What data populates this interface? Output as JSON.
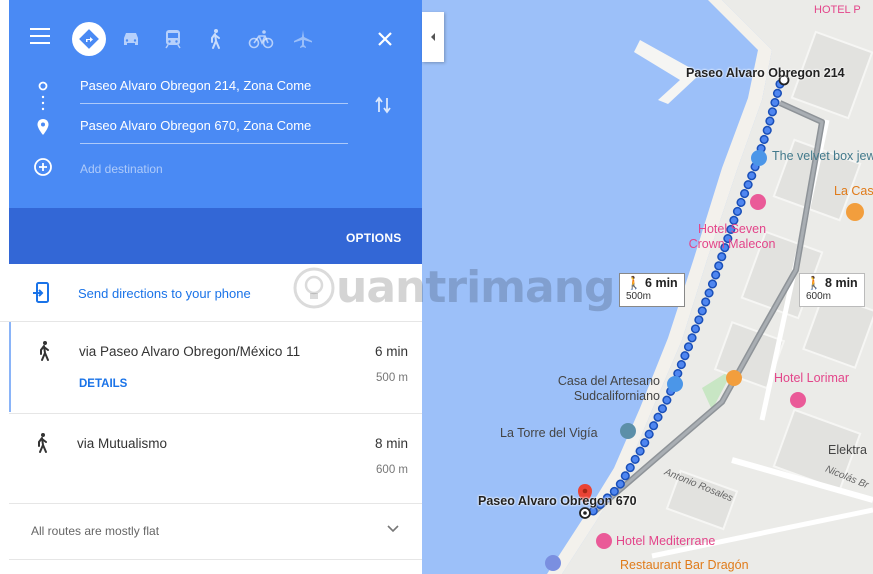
{
  "directions": {
    "travel_modes": [
      "drive",
      "car",
      "transit",
      "walk",
      "bicycle",
      "flight"
    ],
    "origin": "Paseo Alvaro Obregon 214, Zona Come",
    "destination": "Paseo Alvaro Obregon 670, Zona Come",
    "add_destination_placeholder": "Add destination",
    "options_label": "OPTIONS"
  },
  "send_to_phone": {
    "label": "Send directions to your phone"
  },
  "routes": [
    {
      "via": "via Paseo Alvaro Obregon/México 11",
      "time": "6 min",
      "distance": "500 m",
      "details_label": "DETAILS"
    },
    {
      "via": "via Mutualismo",
      "time": "8 min",
      "distance": "600 m"
    }
  ],
  "footer": {
    "flat_note": "All routes are mostly flat"
  },
  "map": {
    "start_label": "Paseo Alvaro Obregon 214",
    "end_label": "Paseo Alvaro Obregon 670",
    "route_badges": [
      {
        "time": "6 min",
        "distance": "500m"
      },
      {
        "time": "8 min",
        "distance": "600m"
      }
    ],
    "places": {
      "hotel_top": "HOTEL P",
      "velvet": "The velvet box jewelry la paz",
      "la_cas": "La Cas",
      "hotel_seven": "Hotel Seven Crown Malecon",
      "hotel_lorimar": "Hotel Lorimar",
      "casa_artesano": "Casa del Artesano Sudcaliforniano",
      "torre_vigia": "La Torre del Vigía",
      "elektra": "Elektra",
      "hotel_mediterrane": "Hotel Mediterrane",
      "restaurant_bar": "Restaurant Bar Dragón"
    },
    "streets": {
      "antonio_rosales": "Antonio Rosales",
      "nicolas_bravo": "Nicolás Br"
    },
    "watermark": "uantrimang"
  },
  "colors": {
    "header_blue": "#4a8af4",
    "header_dark_blue": "#3367d6",
    "link_blue": "#1a73e8",
    "route_blue": "#4f86f0",
    "water": "#9cc0f9"
  }
}
